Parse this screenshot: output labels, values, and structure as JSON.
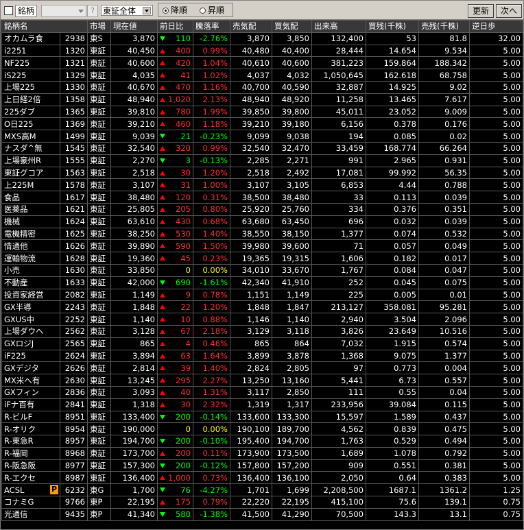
{
  "toolbar": {
    "meigara_label": "銘柄",
    "question": "?",
    "market_filter": "東証全体",
    "sort_desc": "降順",
    "sort_asc": "昇順",
    "sort_selected": "降順",
    "refresh_label": "更新",
    "next_label": "次へ"
  },
  "columns": [
    "銘柄名",
    "",
    "市場",
    "現在値",
    "前日比",
    "騰落率",
    "売気配",
    "買気配",
    "出来高",
    "買残(千株)",
    "売残(千株)",
    "逆日歩"
  ],
  "colors": {
    "up": "#ff3030",
    "down": "#00ff00",
    "flat": "#ffff00",
    "badge": "#ff9900"
  },
  "rows": [
    {
      "name": "オカムラ食",
      "code": "2938",
      "market": "東S",
      "price": "3,870",
      "dir": "down",
      "change": "110",
      "rate": "-2.76%",
      "ask": "3,870",
      "bid": "3,850",
      "volume": "132,400",
      "buy_bal": "53",
      "sell_bal": "81.8",
      "rev": "32.00"
    },
    {
      "name": "i2251",
      "code": "1320",
      "market": "東証",
      "price": "40,450",
      "dir": "up",
      "change": "400",
      "rate": "0.99%",
      "ask": "40,480",
      "bid": "40,400",
      "volume": "28,444",
      "buy_bal": "14.654",
      "sell_bal": "9.534",
      "rev": "5.00"
    },
    {
      "name": "NF225",
      "code": "1321",
      "market": "東証",
      "price": "40,600",
      "dir": "up",
      "change": "420",
      "rate": "1.04%",
      "ask": "40,610",
      "bid": "40,600",
      "volume": "381,223",
      "buy_bal": "159.864",
      "sell_bal": "188.342",
      "rev": "5.00"
    },
    {
      "name": "iS225",
      "code": "1329",
      "market": "東証",
      "price": "4,035",
      "dir": "up",
      "change": "41",
      "rate": "1.02%",
      "ask": "4,037",
      "bid": "4,032",
      "volume": "1,050,645",
      "buy_bal": "162.618",
      "sell_bal": "68.758",
      "rev": "5.00"
    },
    {
      "name": "上場225",
      "code": "1330",
      "market": "東証",
      "price": "40,670",
      "dir": "up",
      "change": "470",
      "rate": "1.16%",
      "ask": "40,700",
      "bid": "40,590",
      "volume": "32,887",
      "buy_bal": "14.925",
      "sell_bal": "9.02",
      "rev": "5.00"
    },
    {
      "name": "上日経2倍",
      "code": "1358",
      "market": "東証",
      "price": "48,940",
      "dir": "up",
      "change": "1,020",
      "rate": "2.13%",
      "ask": "48,940",
      "bid": "48,920",
      "volume": "11,258",
      "buy_bal": "13.465",
      "sell_bal": "7.617",
      "rev": "5.00"
    },
    {
      "name": "225ダブ",
      "code": "1365",
      "market": "東証",
      "price": "39,810",
      "dir": "up",
      "change": "780",
      "rate": "1.99%",
      "ask": "39,850",
      "bid": "39,800",
      "volume": "45,011",
      "buy_bal": "23.052",
      "sell_bal": "9.009",
      "rev": "5.00"
    },
    {
      "name": "O日225",
      "code": "1369",
      "market": "東証",
      "price": "39,210",
      "dir": "up",
      "change": "460",
      "rate": "1.18%",
      "ask": "39,210",
      "bid": "39,180",
      "volume": "6,156",
      "buy_bal": "0.378",
      "sell_bal": "0.176",
      "rev": "5.00"
    },
    {
      "name": "MXS高M",
      "code": "1499",
      "market": "東証",
      "price": "9,039",
      "dir": "down",
      "change": "21",
      "rate": "-0.23%",
      "ask": "9,099",
      "bid": "9,038",
      "volume": "194",
      "buy_bal": "0.085",
      "sell_bal": "0.02",
      "rev": "5.00"
    },
    {
      "name": "ナスダ^無",
      "code": "1545",
      "market": "東証",
      "price": "32,540",
      "dir": "up",
      "change": "320",
      "rate": "0.99%",
      "ask": "32,540",
      "bid": "32,470",
      "volume": "33,459",
      "buy_bal": "168.774",
      "sell_bal": "66.264",
      "rev": "5.00"
    },
    {
      "name": "上場豪州R",
      "code": "1555",
      "market": "東証",
      "price": "2,270",
      "dir": "down",
      "change": "3",
      "rate": "-0.13%",
      "ask": "2,285",
      "bid": "2,271",
      "volume": "991",
      "buy_bal": "2.965",
      "sell_bal": "0.931",
      "rev": "5.00"
    },
    {
      "name": "東証グコア",
      "code": "1563",
      "market": "東証",
      "price": "2,518",
      "dir": "up",
      "change": "30",
      "rate": "1.20%",
      "ask": "2,518",
      "bid": "2,492",
      "volume": "17,081",
      "buy_bal": "99.992",
      "sell_bal": "56.35",
      "rev": "5.00"
    },
    {
      "name": "上225M",
      "code": "1578",
      "market": "東証",
      "price": "3,107",
      "dir": "up",
      "change": "31",
      "rate": "1.00%",
      "ask": "3,107",
      "bid": "3,105",
      "volume": "6,853",
      "buy_bal": "4.44",
      "sell_bal": "0.788",
      "rev": "5.00"
    },
    {
      "name": "食品",
      "code": "1617",
      "market": "東証",
      "price": "38,480",
      "dir": "up",
      "change": "120",
      "rate": "0.31%",
      "ask": "38,500",
      "bid": "38,480",
      "volume": "33",
      "buy_bal": "0.113",
      "sell_bal": "0.039",
      "rev": "5.00"
    },
    {
      "name": "医薬品",
      "code": "1621",
      "market": "東証",
      "price": "25,805",
      "dir": "up",
      "change": "205",
      "rate": "0.80%",
      "ask": "25,920",
      "bid": "25,760",
      "volume": "334",
      "buy_bal": "0.376",
      "sell_bal": "0.351",
      "rev": "5.00"
    },
    {
      "name": "機械",
      "code": "1624",
      "market": "東証",
      "price": "63,610",
      "dir": "up",
      "change": "430",
      "rate": "0.68%",
      "ask": "63,680",
      "bid": "63,450",
      "volume": "696",
      "buy_bal": "0.032",
      "sell_bal": "0.039",
      "rev": "5.00"
    },
    {
      "name": "電機精密",
      "code": "1625",
      "market": "東証",
      "price": "38,250",
      "dir": "up",
      "change": "530",
      "rate": "1.40%",
      "ask": "38,550",
      "bid": "38,150",
      "volume": "1,377",
      "buy_bal": "0.074",
      "sell_bal": "0.532",
      "rev": "5.00"
    },
    {
      "name": "情通他",
      "code": "1626",
      "market": "東証",
      "price": "39,890",
      "dir": "up",
      "change": "590",
      "rate": "1.50%",
      "ask": "39,980",
      "bid": "39,600",
      "volume": "71",
      "buy_bal": "0.057",
      "sell_bal": "0.049",
      "rev": "5.00"
    },
    {
      "name": "運輸物流",
      "code": "1628",
      "market": "東証",
      "price": "19,360",
      "dir": "up",
      "change": "45",
      "rate": "0.23%",
      "ask": "19,365",
      "bid": "19,315",
      "volume": "1,606",
      "buy_bal": "0.182",
      "sell_bal": "0.017",
      "rev": "5.00"
    },
    {
      "name": "小売",
      "code": "1630",
      "market": "東証",
      "price": "33,850",
      "dir": "flat",
      "change": "0",
      "rate": "0.00%",
      "ask": "34,010",
      "bid": "33,670",
      "volume": "1,767",
      "buy_bal": "0.084",
      "sell_bal": "0.047",
      "rev": "5.00"
    },
    {
      "name": "不動産",
      "code": "1633",
      "market": "東証",
      "price": "42,000",
      "dir": "down",
      "change": "690",
      "rate": "-1.61%",
      "ask": "42,340",
      "bid": "41,910",
      "volume": "252",
      "buy_bal": "0.045",
      "sell_bal": "0.075",
      "rev": "5.00"
    },
    {
      "name": "投資家経営",
      "code": "2082",
      "market": "東証",
      "price": "1,149",
      "dir": "up",
      "change": "9",
      "rate": "0.78%",
      "ask": "1,151",
      "bid": "1,149",
      "volume": "225",
      "buy_bal": "0.005",
      "sell_bal": "0.01",
      "rev": "5.00"
    },
    {
      "name": "GX半導",
      "code": "2243",
      "market": "東証",
      "price": "1,848",
      "dir": "up",
      "change": "22",
      "rate": "1.20%",
      "ask": "1,848",
      "bid": "1,847",
      "volume": "213,127",
      "buy_bal": "358.081",
      "sell_bal": "95.281",
      "rev": "5.00"
    },
    {
      "name": "GXUS中",
      "code": "2252",
      "market": "東証",
      "price": "1,140",
      "dir": "up",
      "change": "10",
      "rate": "0.88%",
      "ask": "1,146",
      "bid": "1,140",
      "volume": "2,940",
      "buy_bal": "3.504",
      "sell_bal": "2.096",
      "rev": "5.00"
    },
    {
      "name": "上場ダウヘ",
      "code": "2562",
      "market": "東証",
      "price": "3,128",
      "dir": "up",
      "change": "67",
      "rate": "2.18%",
      "ask": "3,129",
      "bid": "3,118",
      "volume": "3,826",
      "buy_bal": "23.649",
      "sell_bal": "10.516",
      "rev": "5.00"
    },
    {
      "name": "GXロジJ",
      "code": "2565",
      "market": "東証",
      "price": "865",
      "dir": "up",
      "change": "4",
      "rate": "0.46%",
      "ask": "865",
      "bid": "864",
      "volume": "7,032",
      "buy_bal": "1.915",
      "sell_bal": "0.574",
      "rev": "5.00"
    },
    {
      "name": "iF225",
      "code": "2624",
      "market": "東証",
      "price": "3,894",
      "dir": "up",
      "change": "63",
      "rate": "1.64%",
      "ask": "3,899",
      "bid": "3,878",
      "volume": "1,368",
      "buy_bal": "9.075",
      "sell_bal": "1.377",
      "rev": "5.00"
    },
    {
      "name": "GXデジタ",
      "code": "2626",
      "market": "東証",
      "price": "2,814",
      "dir": "up",
      "change": "39",
      "rate": "1.40%",
      "ask": "2,824",
      "bid": "2,805",
      "volume": "97",
      "buy_bal": "0.773",
      "sell_bal": "0.004",
      "rev": "5.00"
    },
    {
      "name": "MX米へ有",
      "code": "2630",
      "market": "東証",
      "price": "13,245",
      "dir": "up",
      "change": "295",
      "rate": "2.27%",
      "ask": "13,250",
      "bid": "13,160",
      "volume": "5,441",
      "buy_bal": "6.73",
      "sell_bal": "0.557",
      "rev": "5.00"
    },
    {
      "name": "GXフィン",
      "code": "2836",
      "market": "東証",
      "price": "3,093",
      "dir": "up",
      "change": "40",
      "rate": "1.31%",
      "ask": "3,117",
      "bid": "2,850",
      "volume": "111",
      "buy_bal": "0.55",
      "sell_bal": "0.04",
      "rev": "5.00"
    },
    {
      "name": "iFナ百有",
      "code": "2841",
      "market": "東証",
      "price": "1,318",
      "dir": "up",
      "change": "30",
      "rate": "2.32%",
      "ask": "1,319",
      "bid": "1,317",
      "volume": "233,956",
      "buy_bal": "39.084",
      "sell_bal": "0.115",
      "rev": "5.00"
    },
    {
      "name": "R-ビルF",
      "code": "8951",
      "market": "東証",
      "price": "133,400",
      "dir": "down",
      "change": "200",
      "rate": "-0.14%",
      "ask": "133,600",
      "bid": "133,300",
      "volume": "15,597",
      "buy_bal": "1.589",
      "sell_bal": "0.437",
      "rev": "5.00"
    },
    {
      "name": "R-オリク",
      "code": "8954",
      "market": "東証",
      "price": "190,000",
      "dir": "flat",
      "change": "0",
      "rate": "0.00%",
      "ask": "190,100",
      "bid": "189,700",
      "volume": "4,562",
      "buy_bal": "0.839",
      "sell_bal": "0.475",
      "rev": "5.00"
    },
    {
      "name": "R-東急R",
      "code": "8957",
      "market": "東証",
      "price": "194,700",
      "dir": "down",
      "change": "200",
      "rate": "-0.10%",
      "ask": "195,400",
      "bid": "194,700",
      "volume": "1,763",
      "buy_bal": "0.529",
      "sell_bal": "0.494",
      "rev": "5.00"
    },
    {
      "name": "R-福岡",
      "code": "8968",
      "market": "東証",
      "price": "173,700",
      "dir": "up",
      "change": "200",
      "rate": "0.11%",
      "ask": "173,900",
      "bid": "173,500",
      "volume": "1,689",
      "buy_bal": "1.078",
      "sell_bal": "0.792",
      "rev": "5.00"
    },
    {
      "name": "R-阪急阪",
      "code": "8977",
      "market": "東証",
      "price": "157,300",
      "dir": "down",
      "change": "200",
      "rate": "-0.12%",
      "ask": "157,800",
      "bid": "157,200",
      "volume": "909",
      "buy_bal": "0.551",
      "sell_bal": "0.381",
      "rev": "5.00"
    },
    {
      "name": "R-エクセ",
      "code": "8987",
      "market": "東証",
      "price": "136,400",
      "dir": "up",
      "change": "1,000",
      "rate": "0.73%",
      "ask": "136,400",
      "bid": "136,100",
      "volume": "2,050",
      "buy_bal": "0.64",
      "sell_bal": "0.383",
      "rev": "5.00"
    },
    {
      "name": "ACSL",
      "badge": "P",
      "code": "6232",
      "market": "東G",
      "price": "1,700",
      "dir": "down",
      "change": "76",
      "rate": "-4.27%",
      "ask": "1,701",
      "bid": "1,699",
      "volume": "2,208,500",
      "buy_bal": "1687.1",
      "sell_bal": "1361.2",
      "rev": "1.25"
    },
    {
      "name": "コナミG",
      "code": "9766",
      "market": "東P",
      "price": "22,195",
      "dir": "up",
      "change": "175",
      "rate": "0.79%",
      "ask": "22,220",
      "bid": "22,195",
      "volume": "415,100",
      "buy_bal": "75.6",
      "sell_bal": "139.1",
      "rev": "0.75"
    },
    {
      "name": "光通信",
      "code": "9435",
      "market": "東P",
      "price": "41,340",
      "dir": "down",
      "change": "580",
      "rate": "-1.38%",
      "ask": "41,500",
      "bid": "41,290",
      "volume": "70,500",
      "buy_bal": "143.3",
      "sell_bal": "13.1",
      "rev": "0.75"
    }
  ]
}
